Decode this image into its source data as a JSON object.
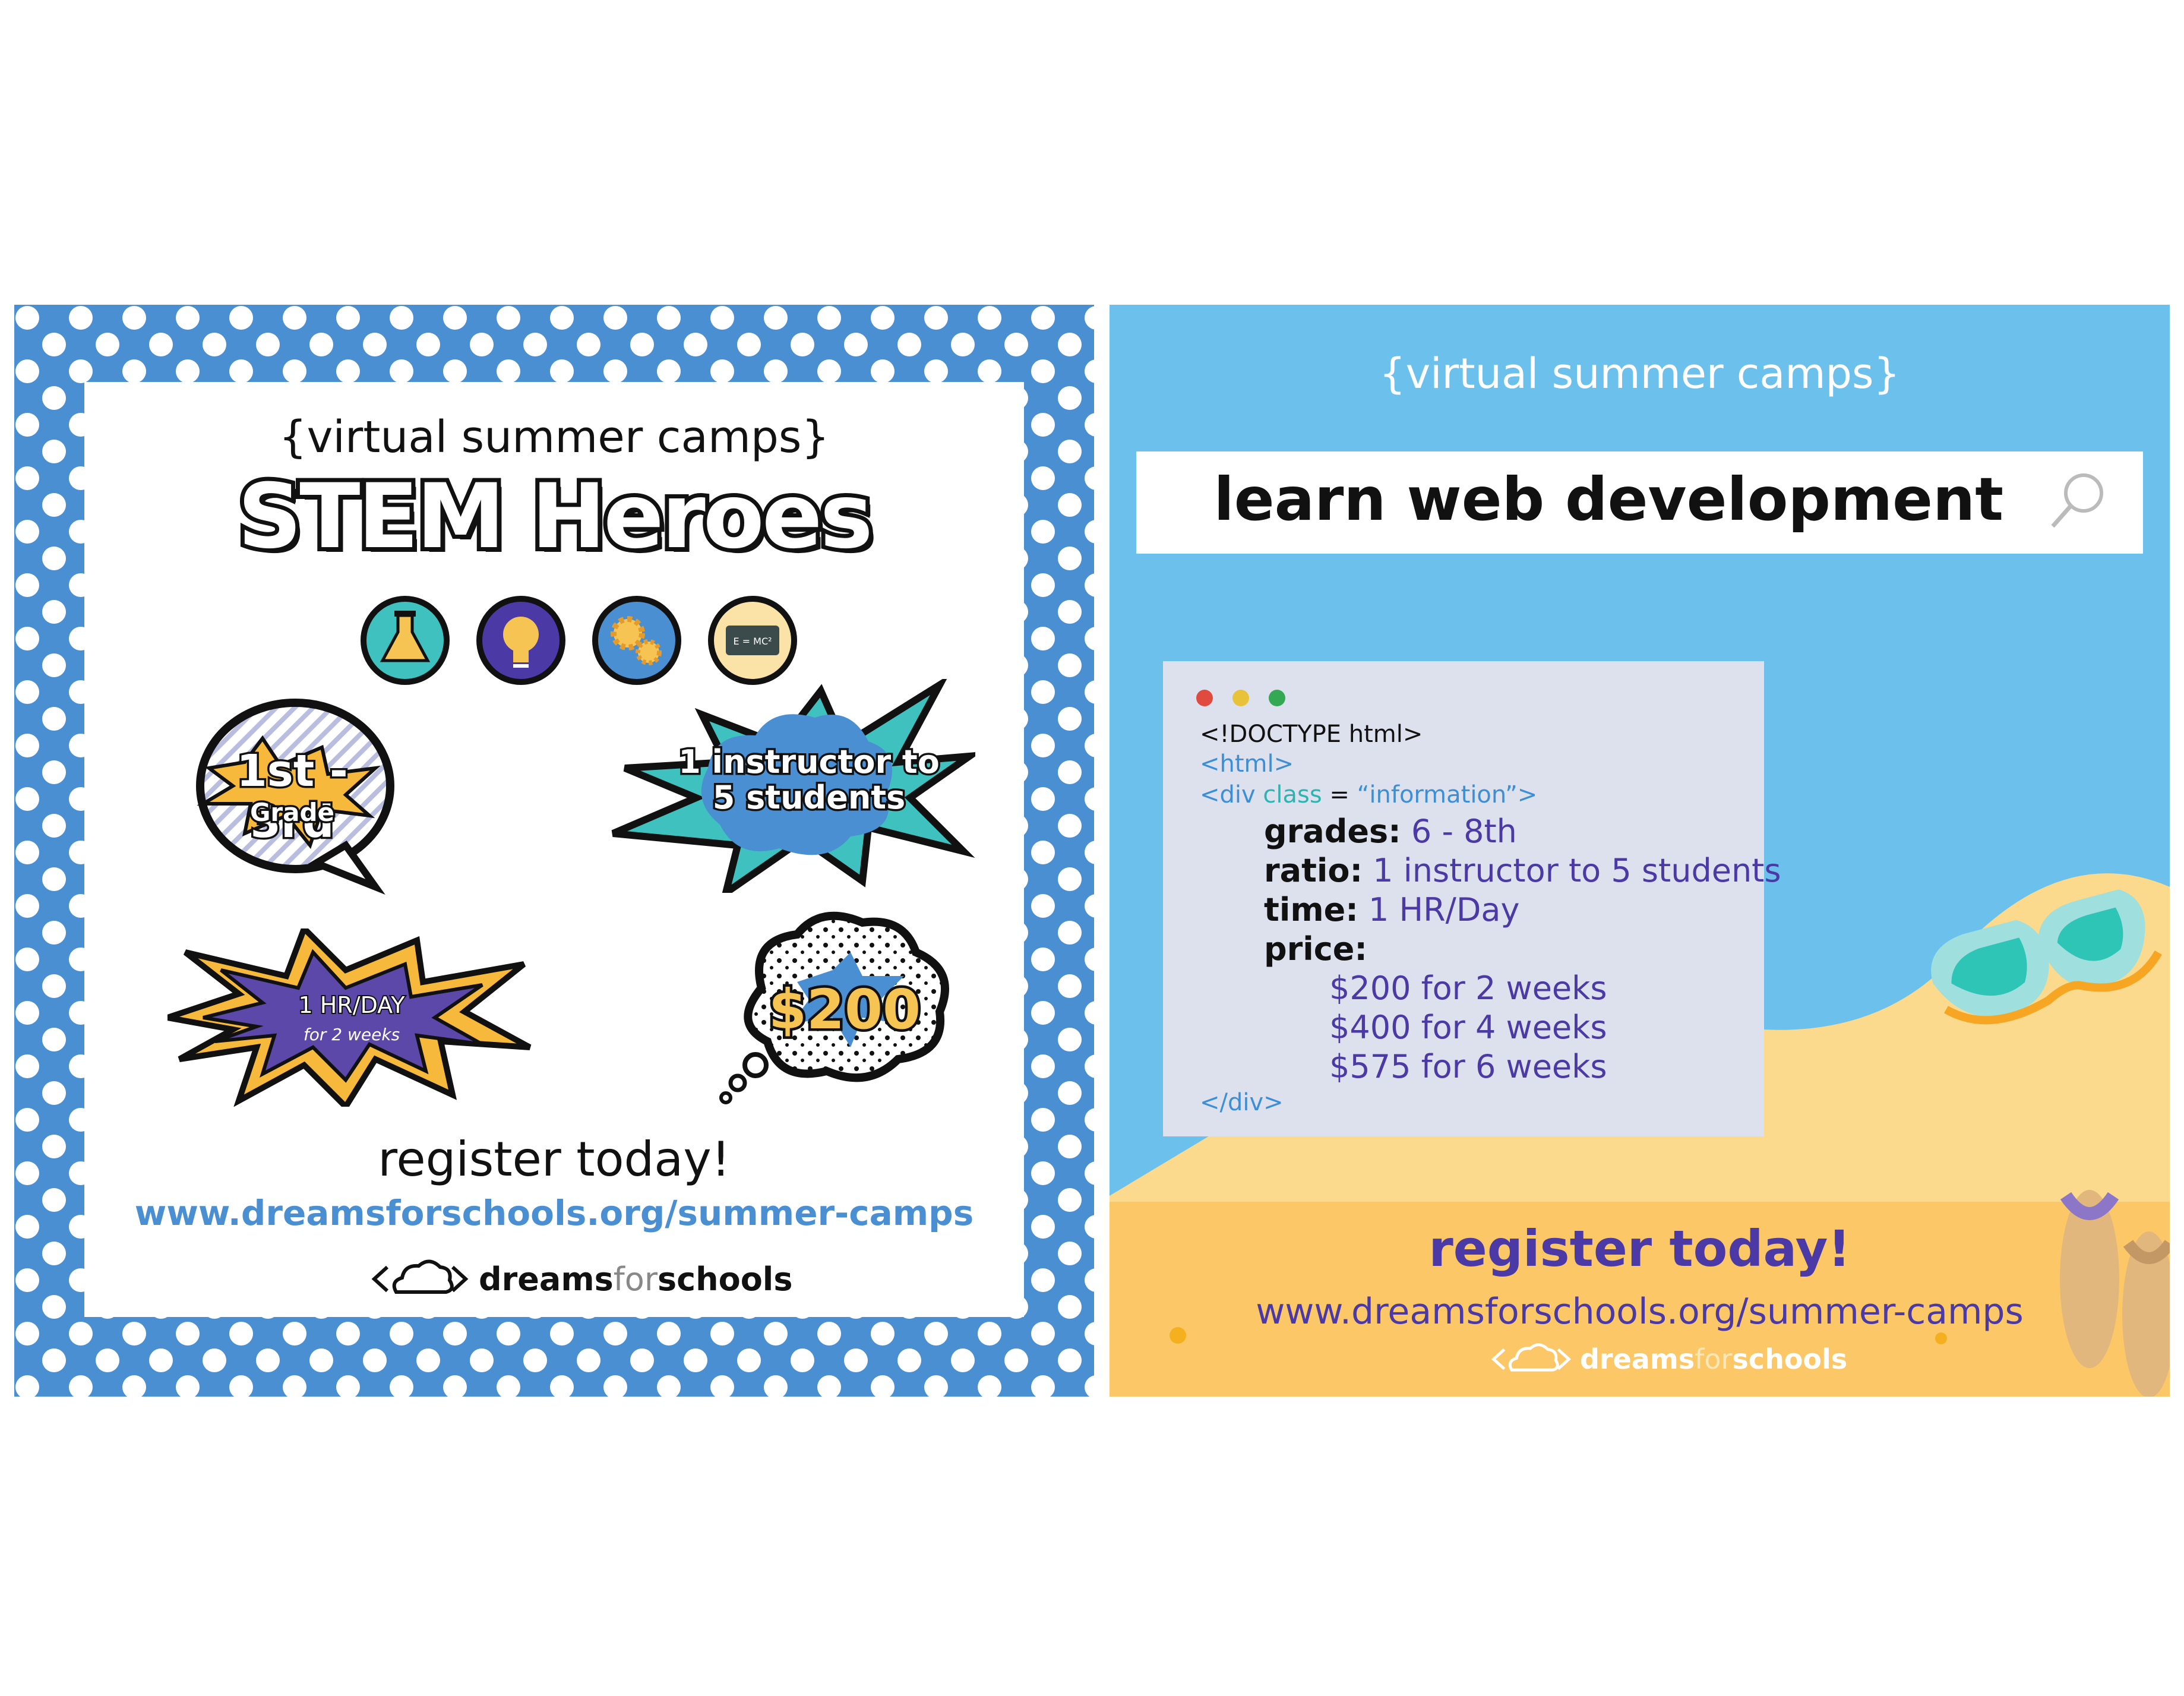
{
  "left_poster": {
    "subtitle": "{virtual summer camps}",
    "title": "STEM Heroes",
    "icons": [
      "flask-icon",
      "lightbulb-icon",
      "gears-icon",
      "chalkboard-icon"
    ],
    "chalkboard_text": "E = MC²",
    "badge_grade": {
      "line1": "1st - 3rd",
      "line2": "Grade"
    },
    "badge_ratio": {
      "line1": "1 instructor to",
      "line2": "5 students"
    },
    "badge_hours": {
      "line1": "1 HR/DAY",
      "line2": "for 2 weeks"
    },
    "badge_price": "$200",
    "register": "register today!",
    "url": "www.dreamsforschools.org/summer-camps",
    "logo": {
      "part1": "dreams",
      "part2": "for",
      "part3": "schools"
    },
    "colors": {
      "border": "#4a8fd2",
      "grade_burst": "#f6b93b",
      "ratio_burst": "#3fc1bf",
      "hours_burst": "#5b48a8"
    }
  },
  "right_poster": {
    "subtitle": "{virtual summer camps}",
    "search_text": "learn web development",
    "code": {
      "doctype": "<!DOCTYPE html>",
      "html_tag": "<html>",
      "div_open_1": "<div",
      "div_class_kw": "class",
      "div_eq": " = ",
      "div_class_val": "“information”>",
      "grades_key": "grades:",
      "grades_val": "6 - 8th",
      "ratio_key": "ratio:",
      "ratio_val": "1 instructor to 5 students",
      "time_key": "time:",
      "time_val": "1 HR/Day",
      "price_key": "price:",
      "prices": [
        "$200 for 2 weeks",
        "$400 for 4 weeks",
        "$575 for 6 weeks"
      ],
      "div_close": "</div>"
    },
    "register": "register today!",
    "url": "www.dreamsforschools.org/summer-camps",
    "logo": {
      "part1": "dreams",
      "part2": "for",
      "part3": "schools"
    },
    "colors": {
      "sky": "#6cc1ec",
      "sand": "#fbd98d",
      "footer": "#fcc867",
      "text": "#4b3aa6"
    }
  }
}
